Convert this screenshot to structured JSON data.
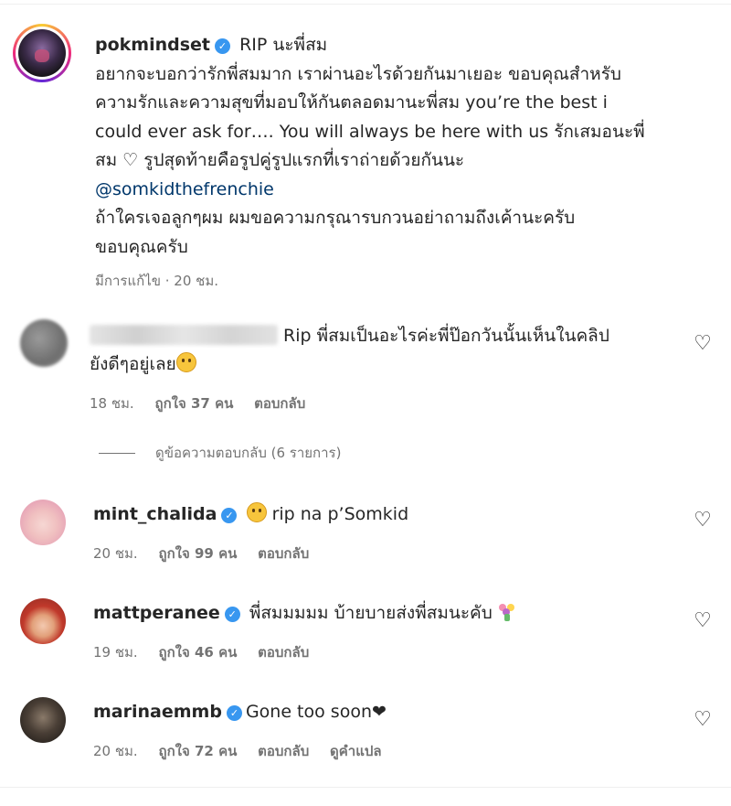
{
  "post": {
    "username": "pokmindset",
    "title": "RIP นะพี่สม",
    "lines": [
      "อยากจะบอกว่ารักพี่สมมาก เราผ่านอะไรด้วยกันมาเยอะ ขอบคุณสำหรับ",
      "ความรักและความสุขที่มอบให้กันตลอดมานะพี่สม you’re the best i",
      "could ever ask for…. You will always be here with us รักเสมอนะพี่",
      "สม"
    ],
    "line4_after_heart": "รูปสุดท้ายคือรูปคู่รูปแรกที่เราถ่ายด้วยกันนะ",
    "mention": "@somkidthefrenchie",
    "lines2": [
      "ถ้าใครเจอลูกๆผม ผมขอความกรุณารบกวนอย่าถามถึงเค้านะครับ",
      "ขอบคุณครับ"
    ],
    "meta": "มีการแก้ไข · 20 ชม."
  },
  "comments": [
    {
      "username_hidden": true,
      "text_line1": "Rip พี่สมเป็นอะไรค่ะพี่ป๊อกวันนั้นเห็นในคลิป",
      "text_line2": "ยังดีๆอยู่เลย",
      "time": "18 ชม.",
      "likes": "ถูกใจ 37 คน",
      "reply": "ตอบกลับ"
    },
    {
      "username": "mint_chalida",
      "text": "rip na p’Somkid",
      "time": "20 ชม.",
      "likes": "ถูกใจ 99 คน",
      "reply": "ตอบกลับ"
    },
    {
      "username": "mattperanee",
      "text": "พี่สมมมมม บ้ายบายส่งพี่สมนะคับ",
      "time": "19 ชม.",
      "likes": "ถูกใจ 46 คน",
      "reply": "ตอบกลับ"
    },
    {
      "username": "marinaemmb",
      "text": "Gone too soon",
      "time": "20 ชม.",
      "likes": "ถูกใจ 72 คน",
      "reply": "ตอบกลับ",
      "translate": "ดูคำแปล"
    }
  ],
  "view_replies": "ดูข้อความตอบกลับ (6 รายการ)",
  "icons": {
    "verified": "verified-badge-icon",
    "like": "heart-outline-icon"
  },
  "colors": {
    "verified": "#3897f0",
    "mention": "#00376b",
    "muted": "#737373"
  }
}
